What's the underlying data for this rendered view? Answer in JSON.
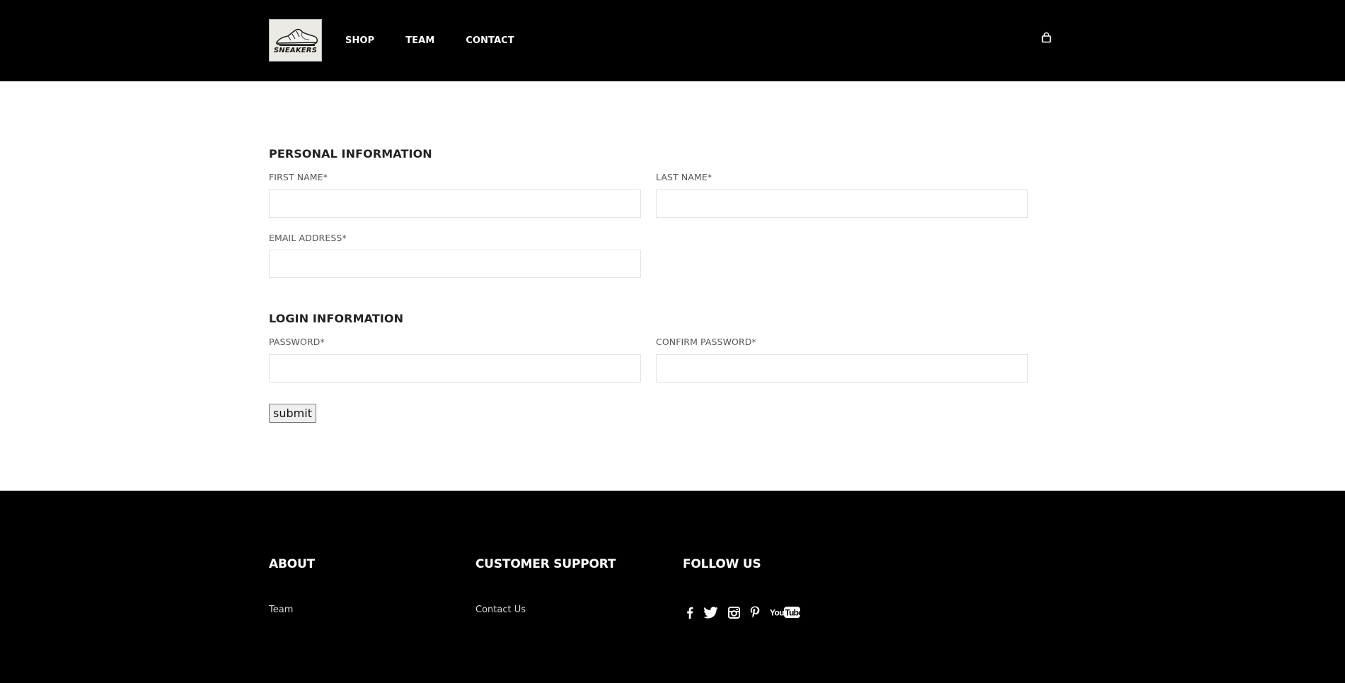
{
  "header": {
    "logo_text": "SNEAKERS",
    "nav": [
      {
        "label": "SHOP"
      },
      {
        "label": "TEAM"
      },
      {
        "label": "CONTACT"
      }
    ],
    "cart_icon": "shopping-bag-icon"
  },
  "form": {
    "personal": {
      "title": "PERSONAL INFORMATION",
      "first_name_label": "FIRST NAME*",
      "first_name_value": "",
      "last_name_label": "LAST NAME*",
      "last_name_value": "",
      "email_label": "EMAIL ADDRESS*",
      "email_value": ""
    },
    "login": {
      "title": "LOGIN INFORMATION",
      "password_label": "PASSWORD*",
      "password_value": "",
      "confirm_label": "CONFIRM PASSWORD*",
      "confirm_value": ""
    },
    "submit_label": "submit"
  },
  "footer": {
    "about": {
      "heading": "ABOUT",
      "links": [
        "Team"
      ]
    },
    "support": {
      "heading": "CUSTOMER SUPPORT",
      "links": [
        "Contact Us"
      ]
    },
    "follow": {
      "heading": "FOLLOW US",
      "icons": [
        "facebook-icon",
        "twitter-icon",
        "instagram-icon",
        "pinterest-icon",
        "youtube-icon"
      ]
    }
  },
  "colors": {
    "header_bg": "#000000",
    "footer_bg": "#000000",
    "page_bg": "#ffffff",
    "input_border": "#e2e2e2"
  }
}
